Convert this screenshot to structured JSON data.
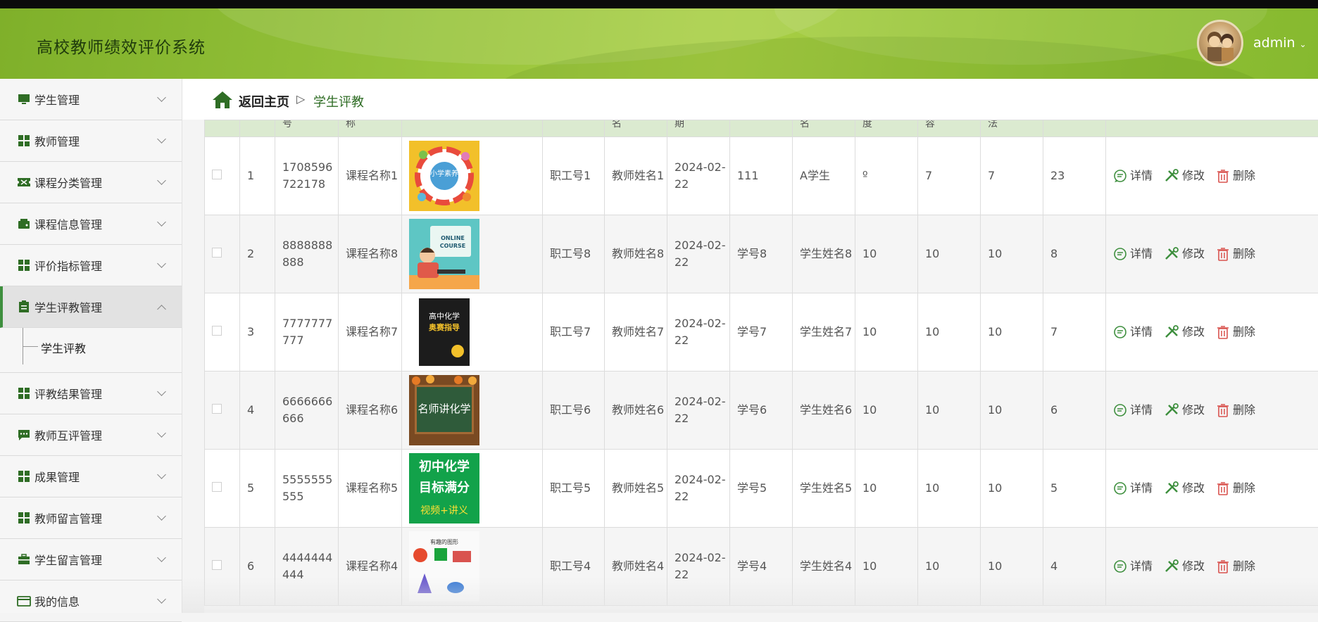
{
  "header": {
    "app_title": "高校教师绩效评价系统",
    "username": "admin"
  },
  "sidebar": {
    "items": [
      {
        "label": "学生管理",
        "icon": "monitor-icon"
      },
      {
        "label": "教师管理",
        "icon": "grid-icon"
      },
      {
        "label": "课程分类管理",
        "icon": "ticket-icon"
      },
      {
        "label": "课程信息管理",
        "icon": "wallet-icon"
      },
      {
        "label": "评价指标管理",
        "icon": "grid-icon"
      },
      {
        "label": "学生评教管理",
        "icon": "clipboard-icon"
      },
      {
        "label": "评教结果管理",
        "icon": "grid-icon"
      },
      {
        "label": "教师互评管理",
        "icon": "chat-icon"
      },
      {
        "label": "成果管理",
        "icon": "grid-icon"
      },
      {
        "label": "教师留言管理",
        "icon": "grid-icon"
      },
      {
        "label": "学生留言管理",
        "icon": "briefcase-icon"
      },
      {
        "label": "我的信息",
        "icon": "card-icon"
      }
    ],
    "submenu_label": "学生评教"
  },
  "breadcrumb": {
    "home": "返回主页",
    "separator": "▷",
    "current": "学生评教"
  },
  "table": {
    "headers": [
      "",
      "",
      "号",
      "称",
      "",
      "",
      "名",
      "期",
      "",
      "名",
      "度",
      "容",
      "法",
      "",
      ""
    ],
    "rows": [
      {
        "index": "1",
        "code": "1708596722178",
        "course": "课程名称1",
        "staff": "职工号1",
        "teacher": "教师姓名1",
        "date": "2024-02-22",
        "student_no": "111",
        "student": "A学生",
        "s1": "º",
        "s2": "7",
        "s3": "7",
        "total": "23"
      },
      {
        "index": "2",
        "code": "8888888888",
        "course": "课程名称8",
        "staff": "职工号8",
        "teacher": "教师姓名8",
        "date": "2024-02-22",
        "student_no": "学号8",
        "student": "学生姓名8",
        "s1": "10",
        "s2": "10",
        "s3": "10",
        "total": "8"
      },
      {
        "index": "3",
        "code": "7777777777",
        "course": "课程名称7",
        "staff": "职工号7",
        "teacher": "教师姓名7",
        "date": "2024-02-22",
        "student_no": "学号7",
        "student": "学生姓名7",
        "s1": "10",
        "s2": "10",
        "s3": "10",
        "total": "7"
      },
      {
        "index": "4",
        "code": "6666666666",
        "course": "课程名称6",
        "staff": "职工号6",
        "teacher": "教师姓名6",
        "date": "2024-02-22",
        "student_no": "学号6",
        "student": "学生姓名6",
        "s1": "10",
        "s2": "10",
        "s3": "10",
        "total": "6"
      },
      {
        "index": "5",
        "code": "5555555555",
        "course": "课程名称5",
        "staff": "职工号5",
        "teacher": "教师姓名5",
        "date": "2024-02-22",
        "student_no": "学号5",
        "student": "学生姓名5",
        "s1": "10",
        "s2": "10",
        "s3": "10",
        "total": "5"
      },
      {
        "index": "6",
        "code": "4444444444",
        "course": "课程名称4",
        "staff": "职工号4",
        "teacher": "教师姓名4",
        "date": "2024-02-22",
        "student_no": "学号4",
        "student": "学生姓名4",
        "s1": "10",
        "s2": "10",
        "s3": "10",
        "total": "4"
      }
    ],
    "actions": {
      "detail": "详情",
      "edit": "修改",
      "delete": "删除"
    }
  },
  "thumb_text": {
    "t1": "小学素养",
    "t2": "ONLINE COURSE",
    "t3": "高中化学",
    "t3b": "奥赛指导",
    "t4": "名师讲化学",
    "t5a": "初中化学",
    "t5b": "目标满分",
    "t5c": "视频+讲义",
    "t6": "有趣的图形"
  },
  "colors": {
    "accent": "#3e8f3e",
    "header_green": "#95c23a",
    "delete_red": "#d9534f"
  }
}
